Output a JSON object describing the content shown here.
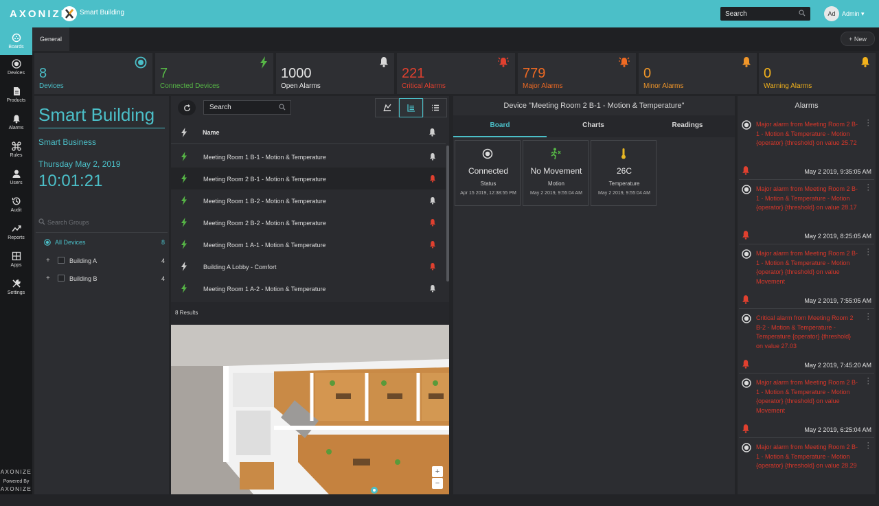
{
  "header": {
    "brand": "AXONIZE",
    "app_name": "Smart Building",
    "search_label": "Search",
    "avatar_initials": "Ad",
    "user_name": "Admin ▾"
  },
  "sidebar": {
    "items": [
      {
        "label": "Boards",
        "icon": "boards-icon"
      },
      {
        "label": "Devices",
        "icon": "devices-icon"
      },
      {
        "label": "Products",
        "icon": "products-icon"
      },
      {
        "label": "Alarms",
        "icon": "bell-icon"
      },
      {
        "label": "Rules",
        "icon": "rules-icon"
      },
      {
        "label": "Users",
        "icon": "user-icon"
      },
      {
        "label": "Audit",
        "icon": "history-icon"
      },
      {
        "label": "Reports",
        "icon": "trend-icon"
      },
      {
        "label": "Apps",
        "icon": "grid-icon"
      },
      {
        "label": "Settings",
        "icon": "tools-icon"
      }
    ],
    "footer_brand": "AXONIZE",
    "powered_by": "Powered By",
    "footer_logo": "AXONIZE"
  },
  "tabs": {
    "general": "General",
    "new_label": "+ New"
  },
  "stats": [
    {
      "value": "8",
      "label": "Devices",
      "color": "#4bbfc8",
      "icon": "target-icon"
    },
    {
      "value": "7",
      "label": "Connected Devices",
      "color": "#56b646",
      "icon": "bolt-icon"
    },
    {
      "value": "1000",
      "label": "Open Alarms",
      "color": "#e5e5e5",
      "icon": "bell-icon"
    },
    {
      "value": "221",
      "label": "Critical Alarms",
      "color": "#e0402f",
      "icon": "siren-icon"
    },
    {
      "value": "779",
      "label": "Major Alarms",
      "color": "#ef6a23",
      "icon": "siren-icon"
    },
    {
      "value": "0",
      "label": "Minor Alarms",
      "color": "#f0962a",
      "icon": "bell-icon"
    },
    {
      "value": "0",
      "label": "Warning Alarms",
      "color": "#f2b21c",
      "icon": "bell-icon"
    }
  ],
  "summary": {
    "title": "Smart Building",
    "subtitle": "Smart Business",
    "date": "Thursday May 2, 2019",
    "time": "10:01:21",
    "search_placeholder": "Search Groups",
    "groups": [
      {
        "label": "All Devices",
        "count": "8",
        "type": "radio"
      },
      {
        "label": "Building A",
        "count": "4",
        "type": "checkbox"
      },
      {
        "label": "Building B",
        "count": "4",
        "type": "checkbox"
      }
    ]
  },
  "device_list": {
    "search_label": "Search",
    "header_name": "Name",
    "rows": [
      {
        "name": "Meeting Room 1 B-1 - Motion & Temperature",
        "connected": true,
        "alarm": false
      },
      {
        "name": "Meeting Room 2 B-1 - Motion & Temperature",
        "connected": true,
        "alarm": true
      },
      {
        "name": "Meeting Room 1 B-2 - Motion & Temperature",
        "connected": true,
        "alarm": false
      },
      {
        "name": "Meeting Room 2 B-2 - Motion & Temperature",
        "connected": true,
        "alarm": true
      },
      {
        "name": "Meeting Room 1 A-1 - Motion & Temperature",
        "connected": true,
        "alarm": true
      },
      {
        "name": "Building A Lobby - Comfort",
        "connected": false,
        "alarm": true
      },
      {
        "name": "Meeting Room 1 A-2 - Motion & Temperature",
        "connected": true,
        "alarm": false
      }
    ],
    "results": "8 Results",
    "zoom_in": "+",
    "zoom_out": "−"
  },
  "device_detail": {
    "title": "Device \"Meeting Room 2 B-1 - Motion & Temperature\"",
    "tabs": [
      "Board",
      "Charts",
      "Readings"
    ],
    "cards": [
      {
        "value": "Connected",
        "label": "Status",
        "timestamp": "Apr 15 2019, 12:38:55 PM",
        "icon": "target-icon"
      },
      {
        "value": "No Movement",
        "label": "Motion",
        "timestamp": "May 2 2019, 9:55:04 AM",
        "icon": "motion-icon"
      },
      {
        "value": "26C",
        "label": "Temperature",
        "timestamp": "May 2 2019, 9:55:04 AM",
        "icon": "thermometer-icon"
      }
    ]
  },
  "alarms": {
    "title": "Alarms",
    "entries": [
      {
        "message": "Major alarm from Meeting Room 2 B-1 - Motion & Temperature - Motion {operator} {threshold} on value 25.72",
        "date": "May 2 2019, 9:35:05 AM"
      },
      {
        "message": "Major alarm from Meeting Room 2 B-1 - Motion & Temperature - Motion {operator} {threshold} on value 28.17",
        "date": "May 2 2019, 8:25:05 AM"
      },
      {
        "message": "Major alarm from Meeting Room 2 B-1 - Motion & Temperature - Motion {operator} {threshold} on value Movement",
        "date": "May 2 2019, 7:55:05 AM"
      },
      {
        "message": "Critical alarm from Meeting Room 2 B-2 - Motion & Temperature - Temperature {operator} {threshold} on value 27.03",
        "date": "May 2 2019, 7:45:20 AM"
      },
      {
        "message": "Major alarm from Meeting Room 2 B-1 - Motion & Temperature - Motion {operator} {threshold} on value Movement",
        "date": "May 2 2019, 6:25:04 AM"
      },
      {
        "message": "Major alarm from Meeting Room 2 B-1 - Motion & Temperature - Motion {operator} {threshold} on value 28.29",
        "date": ""
      }
    ]
  }
}
